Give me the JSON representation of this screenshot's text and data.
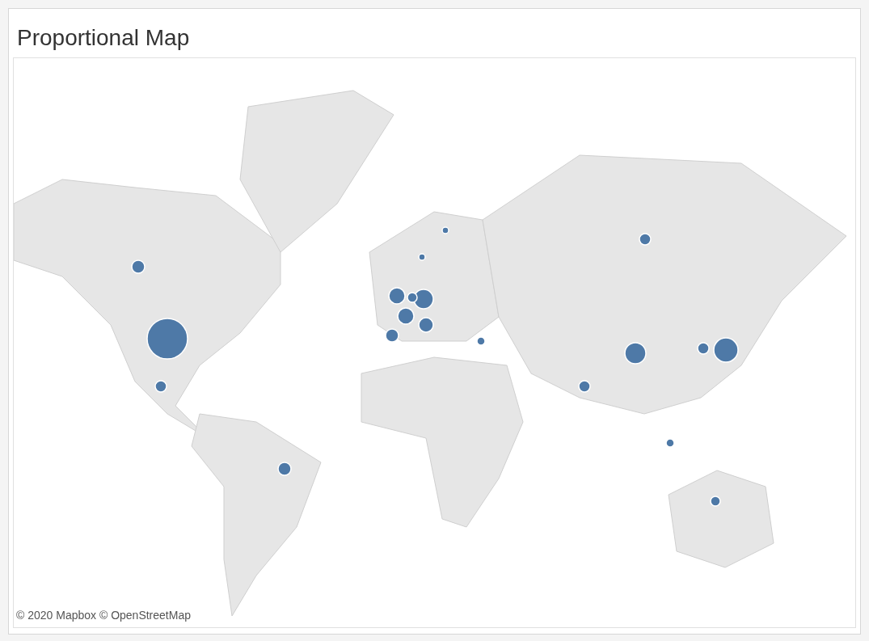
{
  "title": "Proportional Map",
  "map": {
    "kind": "picture",
    "attribution": "© 2020 Mapbox © OpenStreetMap"
  }
}
